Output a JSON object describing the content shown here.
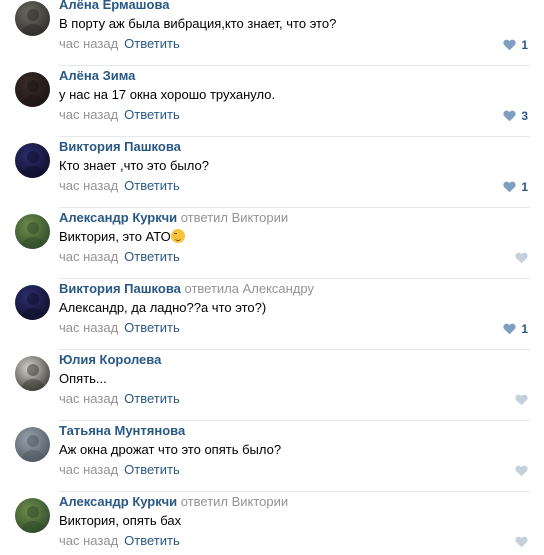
{
  "comments": [
    {
      "author": "Алёна Ермашова",
      "reply_to": "",
      "text": "В порту аж была вибрация,кто знает, что это?",
      "time": "час назад",
      "reply_label": "Ответить",
      "likes": "1",
      "liked": true,
      "avatar_colors": [
        "#6c6a64",
        "#2e2c28"
      ]
    },
    {
      "author": "Алёна Зима",
      "reply_to": "",
      "text": "у нас на 17 окна хорошо трухануло.",
      "time": "час назад",
      "reply_label": "Ответить",
      "likes": "3",
      "liked": true,
      "avatar_colors": [
        "#3a2a28",
        "#1b1514"
      ]
    },
    {
      "author": "Виктория Пашкова",
      "reply_to": "",
      "text": "Кто знает ,что это было?",
      "time": "час назад",
      "reply_label": "Ответить",
      "likes": "1",
      "liked": true,
      "avatar_colors": [
        "#2c2e6e",
        "#0e0e2a"
      ]
    },
    {
      "author": "Александр Куркчи",
      "reply_to": "ответил Виктории",
      "text": "Виктория, это АТО",
      "emoji": "winking-face",
      "time": "час назад",
      "reply_label": "Ответить",
      "likes": "",
      "liked": false,
      "avatar_colors": [
        "#6f8c4a",
        "#2d4a2a"
      ]
    },
    {
      "author": "Виктория Пашкова",
      "reply_to": "ответила Александру",
      "text": "Александр, да ладно??а что это?)",
      "time": "час назад",
      "reply_label": "Ответить",
      "likes": "1",
      "liked": true,
      "avatar_colors": [
        "#2c2e6e",
        "#0e0e2a"
      ]
    },
    {
      "author": "Юлия Королева",
      "reply_to": "",
      "text": "Опять...",
      "time": "час назад",
      "reply_label": "Ответить",
      "likes": "",
      "liked": false,
      "avatar_colors": [
        "#d7d4ce",
        "#3a3835"
      ]
    },
    {
      "author": "Татьяна Мунтянова",
      "reply_to": "",
      "text": "Аж окна дрожат что это опять было?",
      "time": "час назад",
      "reply_label": "Ответить",
      "likes": "",
      "liked": false,
      "avatar_colors": [
        "#9aa3ad",
        "#4d5560"
      ]
    },
    {
      "author": "Александр Куркчи",
      "reply_to": "ответил Виктории",
      "text": "Виктория, опять бах",
      "time": "час назад",
      "reply_label": "Ответить",
      "likes": "",
      "liked": false,
      "avatar_colors": [
        "#6f8c4a",
        "#2d4a2a"
      ]
    }
  ],
  "icons": {
    "like": "heart-icon",
    "emoji": "winking-face-emoji"
  },
  "colors": {
    "link": "#2a5885",
    "muted": "#939393",
    "heart_inactive": "#c5d0db",
    "heart_active": "#7f9fc0",
    "separator": "#e7e8ec"
  }
}
